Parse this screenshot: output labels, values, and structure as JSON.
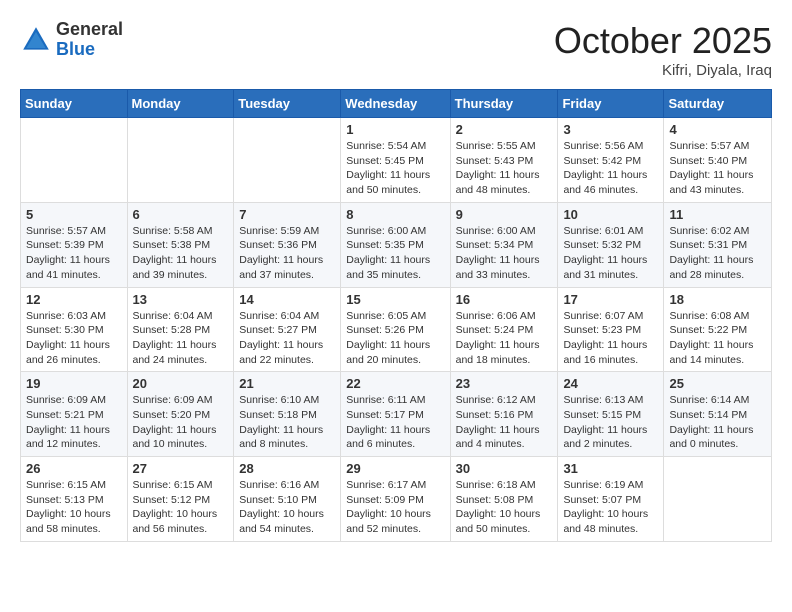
{
  "logo": {
    "general": "General",
    "blue": "Blue"
  },
  "title": "October 2025",
  "location": "Kifri, Diyala, Iraq",
  "weekdays": [
    "Sunday",
    "Monday",
    "Tuesday",
    "Wednesday",
    "Thursday",
    "Friday",
    "Saturday"
  ],
  "weeks": [
    [
      {
        "day": "",
        "info": ""
      },
      {
        "day": "",
        "info": ""
      },
      {
        "day": "",
        "info": ""
      },
      {
        "day": "1",
        "info": "Sunrise: 5:54 AM\nSunset: 5:45 PM\nDaylight: 11 hours and 50 minutes."
      },
      {
        "day": "2",
        "info": "Sunrise: 5:55 AM\nSunset: 5:43 PM\nDaylight: 11 hours and 48 minutes."
      },
      {
        "day": "3",
        "info": "Sunrise: 5:56 AM\nSunset: 5:42 PM\nDaylight: 11 hours and 46 minutes."
      },
      {
        "day": "4",
        "info": "Sunrise: 5:57 AM\nSunset: 5:40 PM\nDaylight: 11 hours and 43 minutes."
      }
    ],
    [
      {
        "day": "5",
        "info": "Sunrise: 5:57 AM\nSunset: 5:39 PM\nDaylight: 11 hours and 41 minutes."
      },
      {
        "day": "6",
        "info": "Sunrise: 5:58 AM\nSunset: 5:38 PM\nDaylight: 11 hours and 39 minutes."
      },
      {
        "day": "7",
        "info": "Sunrise: 5:59 AM\nSunset: 5:36 PM\nDaylight: 11 hours and 37 minutes."
      },
      {
        "day": "8",
        "info": "Sunrise: 6:00 AM\nSunset: 5:35 PM\nDaylight: 11 hours and 35 minutes."
      },
      {
        "day": "9",
        "info": "Sunrise: 6:00 AM\nSunset: 5:34 PM\nDaylight: 11 hours and 33 minutes."
      },
      {
        "day": "10",
        "info": "Sunrise: 6:01 AM\nSunset: 5:32 PM\nDaylight: 11 hours and 31 minutes."
      },
      {
        "day": "11",
        "info": "Sunrise: 6:02 AM\nSunset: 5:31 PM\nDaylight: 11 hours and 28 minutes."
      }
    ],
    [
      {
        "day": "12",
        "info": "Sunrise: 6:03 AM\nSunset: 5:30 PM\nDaylight: 11 hours and 26 minutes."
      },
      {
        "day": "13",
        "info": "Sunrise: 6:04 AM\nSunset: 5:28 PM\nDaylight: 11 hours and 24 minutes."
      },
      {
        "day": "14",
        "info": "Sunrise: 6:04 AM\nSunset: 5:27 PM\nDaylight: 11 hours and 22 minutes."
      },
      {
        "day": "15",
        "info": "Sunrise: 6:05 AM\nSunset: 5:26 PM\nDaylight: 11 hours and 20 minutes."
      },
      {
        "day": "16",
        "info": "Sunrise: 6:06 AM\nSunset: 5:24 PM\nDaylight: 11 hours and 18 minutes."
      },
      {
        "day": "17",
        "info": "Sunrise: 6:07 AM\nSunset: 5:23 PM\nDaylight: 11 hours and 16 minutes."
      },
      {
        "day": "18",
        "info": "Sunrise: 6:08 AM\nSunset: 5:22 PM\nDaylight: 11 hours and 14 minutes."
      }
    ],
    [
      {
        "day": "19",
        "info": "Sunrise: 6:09 AM\nSunset: 5:21 PM\nDaylight: 11 hours and 12 minutes."
      },
      {
        "day": "20",
        "info": "Sunrise: 6:09 AM\nSunset: 5:20 PM\nDaylight: 11 hours and 10 minutes."
      },
      {
        "day": "21",
        "info": "Sunrise: 6:10 AM\nSunset: 5:18 PM\nDaylight: 11 hours and 8 minutes."
      },
      {
        "day": "22",
        "info": "Sunrise: 6:11 AM\nSunset: 5:17 PM\nDaylight: 11 hours and 6 minutes."
      },
      {
        "day": "23",
        "info": "Sunrise: 6:12 AM\nSunset: 5:16 PM\nDaylight: 11 hours and 4 minutes."
      },
      {
        "day": "24",
        "info": "Sunrise: 6:13 AM\nSunset: 5:15 PM\nDaylight: 11 hours and 2 minutes."
      },
      {
        "day": "25",
        "info": "Sunrise: 6:14 AM\nSunset: 5:14 PM\nDaylight: 11 hours and 0 minutes."
      }
    ],
    [
      {
        "day": "26",
        "info": "Sunrise: 6:15 AM\nSunset: 5:13 PM\nDaylight: 10 hours and 58 minutes."
      },
      {
        "day": "27",
        "info": "Sunrise: 6:15 AM\nSunset: 5:12 PM\nDaylight: 10 hours and 56 minutes."
      },
      {
        "day": "28",
        "info": "Sunrise: 6:16 AM\nSunset: 5:10 PM\nDaylight: 10 hours and 54 minutes."
      },
      {
        "day": "29",
        "info": "Sunrise: 6:17 AM\nSunset: 5:09 PM\nDaylight: 10 hours and 52 minutes."
      },
      {
        "day": "30",
        "info": "Sunrise: 6:18 AM\nSunset: 5:08 PM\nDaylight: 10 hours and 50 minutes."
      },
      {
        "day": "31",
        "info": "Sunrise: 6:19 AM\nSunset: 5:07 PM\nDaylight: 10 hours and 48 minutes."
      },
      {
        "day": "",
        "info": ""
      }
    ]
  ]
}
